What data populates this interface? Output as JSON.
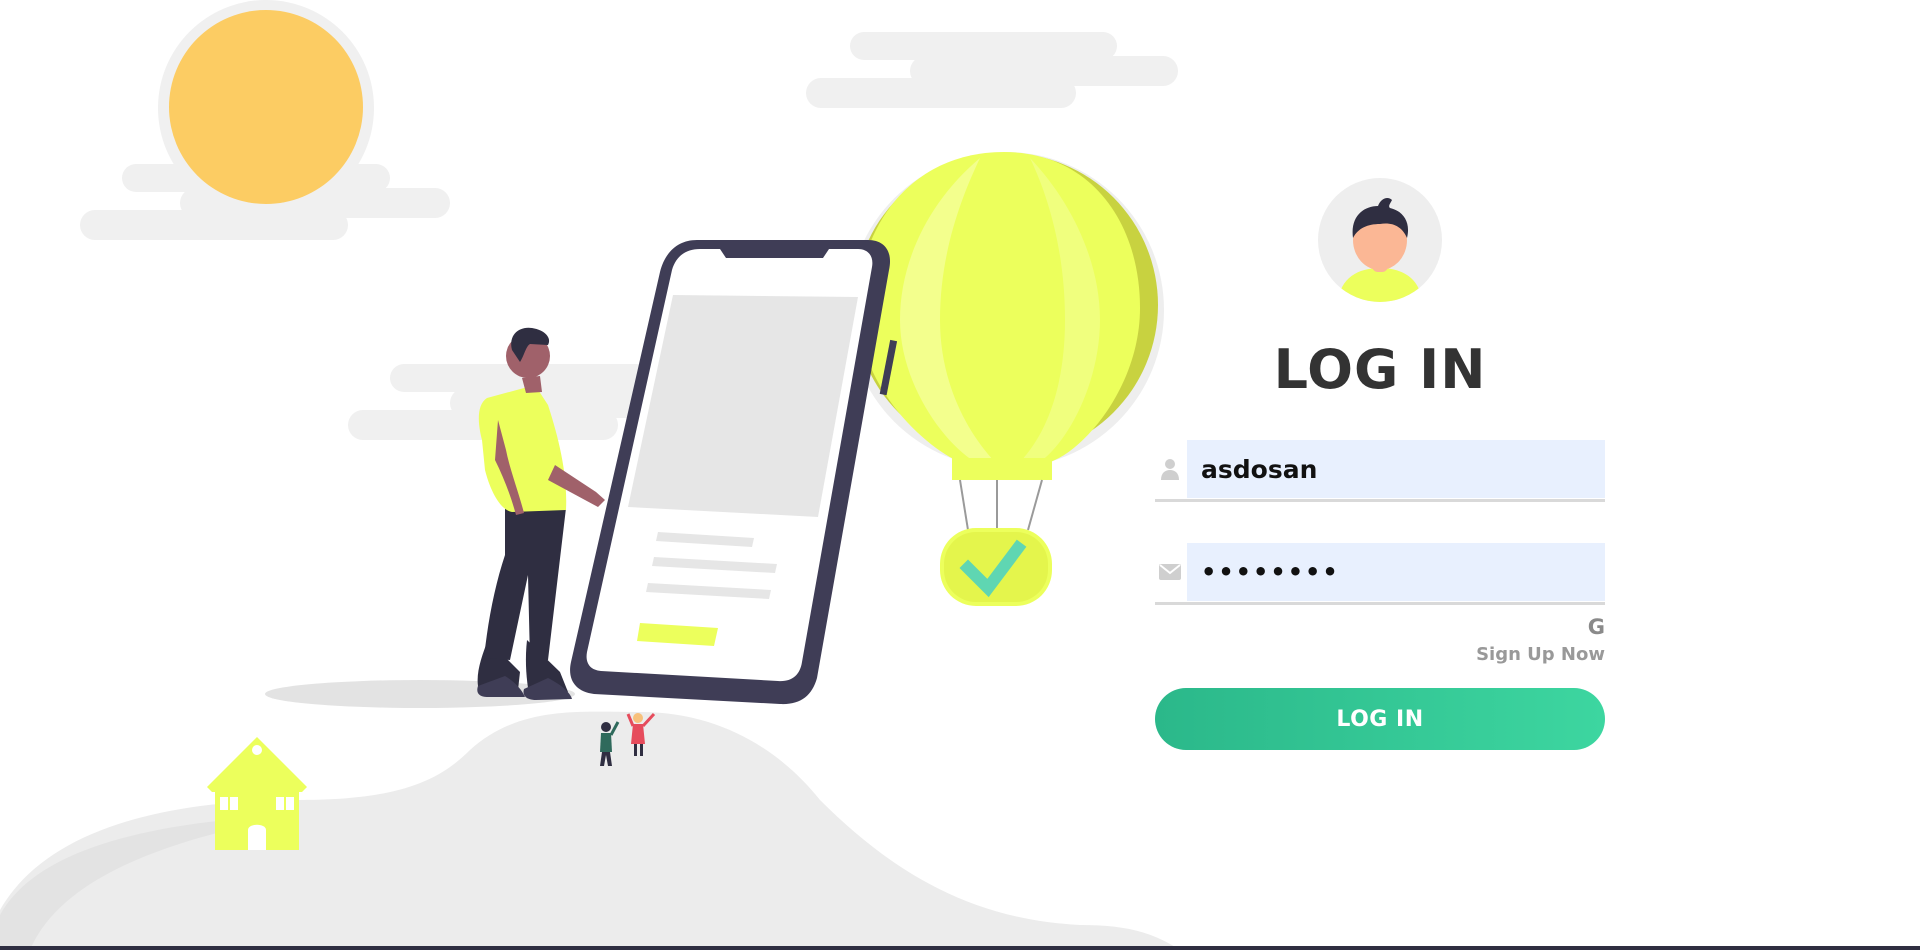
{
  "colors": {
    "accent_yellow": "#ecff5c",
    "sun": "#fccc63",
    "button_start": "#2bb88a",
    "button_end": "#3dd6a0",
    "input_bg": "#e8f0fe",
    "title": "#333333",
    "ground": "#ececec",
    "cloud": "#f0f0f0"
  },
  "illustration": {
    "name": "person-with-phone-and-balloon",
    "icons": [
      "sun",
      "cloud",
      "phone",
      "person",
      "hot-air-balloon",
      "checkmark-icon",
      "house",
      "waving-people",
      "hill"
    ]
  },
  "login": {
    "avatar_icon": "user-avatar-icon",
    "title": "LOG IN",
    "username": {
      "icon": "user-icon",
      "value": "asdosan"
    },
    "password": {
      "icon": "envelope-icon",
      "value": "asdosan1"
    },
    "google_label": "G",
    "signup_label": "Sign Up Now",
    "button_label": "LOG IN"
  }
}
